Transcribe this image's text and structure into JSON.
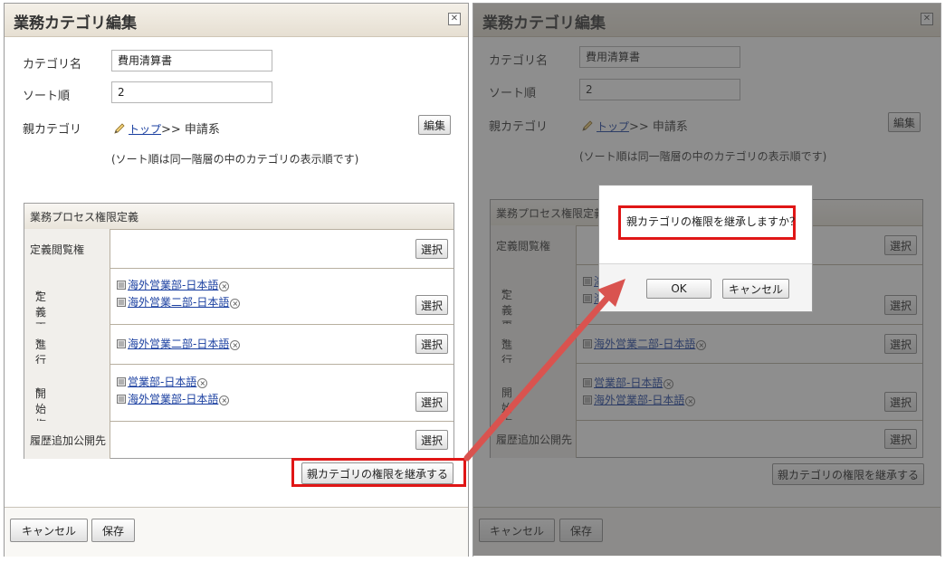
{
  "dialog_title": "業務カテゴリ編集",
  "form": {
    "category_name_label": "カテゴリ名",
    "category_name_value": "費用清算書",
    "sort_label": "ソート順",
    "sort_value": "2",
    "parent_label": "親カテゴリ",
    "parent_link": "トップ",
    "parent_path_rest": ">> 申請系",
    "edit_button": "編集",
    "sort_note": "(ソート順は同一階層の中のカテゴリの表示順です)"
  },
  "permissions": {
    "header": "業務プロセス権限定義",
    "select_label": "選択",
    "rows": [
      {
        "label": "定義閲覧権",
        "required": false,
        "entries": []
      },
      {
        "label": "定義更新権",
        "required": true,
        "entries": [
          "海外営業部-日本語",
          "海外営業二部-日本語"
        ]
      },
      {
        "label": "進行管理権",
        "required": true,
        "entries": [
          "海外営業二部-日本語"
        ]
      },
      {
        "label": "開始権",
        "required": true,
        "entries": [
          "営業部-日本語",
          "海外営業部-日本語"
        ]
      },
      {
        "label": "履歴追加公開先",
        "required": false,
        "entries": []
      }
    ],
    "required_mark": "*"
  },
  "inherit_button": "親カテゴリの権限を継承する",
  "footer": {
    "cancel_button": "キャンセル",
    "save_button": "保存"
  },
  "confirm": {
    "message": "親カテゴリの権限を継承しますか？",
    "ok_button": "OK",
    "cancel_button": "キャンセル"
  },
  "colors": {
    "highlight": "#e01616",
    "arrow": "#d9534f",
    "link": "#1a3fa0"
  }
}
